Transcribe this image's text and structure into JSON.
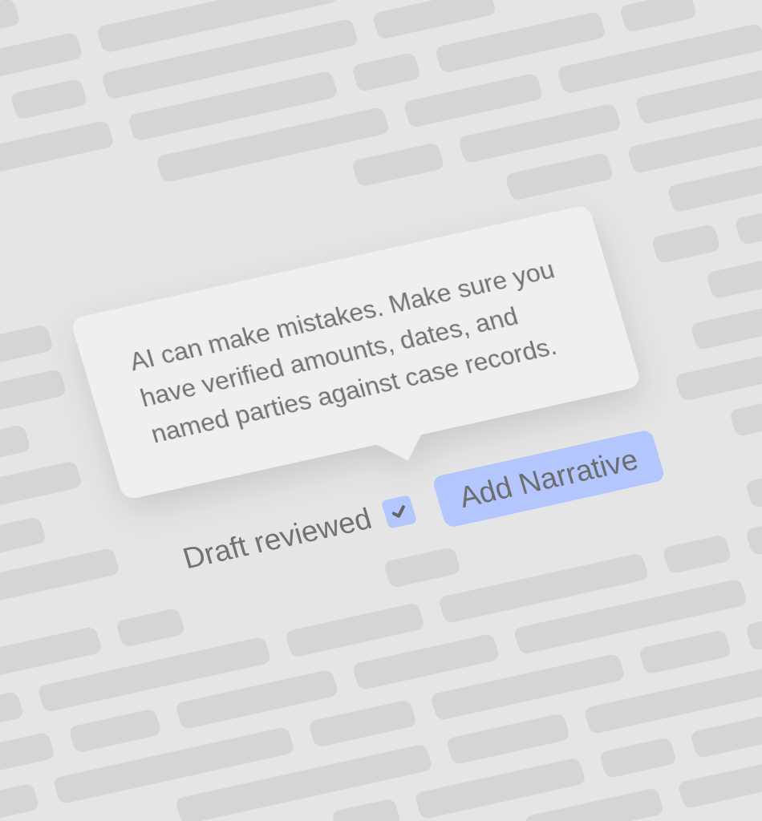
{
  "tooltip": {
    "text": "AI can make mistakes. Make sure you have verified amounts, dates, and named parties against case records."
  },
  "review": {
    "label": "Draft reviewed",
    "checked": true
  },
  "button": {
    "label": "Add Narrative"
  }
}
